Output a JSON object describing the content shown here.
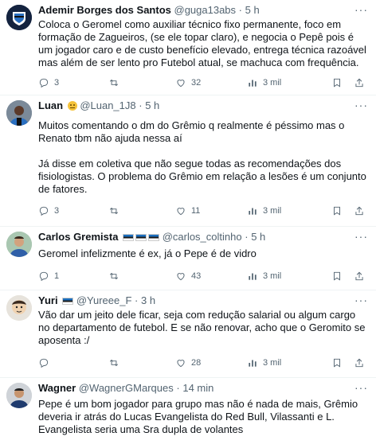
{
  "tweets": [
    {
      "name": "Ademir Borges dos Santos",
      "handle": "@guga13abs",
      "time": "5 h",
      "lines": [
        "Coloca o Geromel como auxiliar técnico fixo permanente, foco em formação de Zagueiros, (se ele topar claro), e negocia o Pepê pois é um jogador caro e de custo benefício elevado, entrega técnica razoável mas além de ser lento pro Futebol atual, se machuca com frequência."
      ],
      "replies": "3",
      "retweets": "",
      "likes": "32",
      "views": "3 mil",
      "avatar": "gremio-crest-avatar"
    },
    {
      "name": "Luan",
      "handle": "@Luan_1J8",
      "time": "5 h",
      "lines": [
        "Muitos comentando o dm do Grêmio q realmente é péssimo mas o Renato tbm não ajuda nessa aí",
        "Já disse em coletiva que não segue todas as recomendações dos fisiologistas. O problema do Grêmio em relação a lesões é um conjunto de fatores."
      ],
      "replies": "3",
      "retweets": "",
      "likes": "11",
      "views": "3 mil",
      "avatar": "player-photo-avatar"
    },
    {
      "name": "Carlos Gremista",
      "handle": "@carlos_coltinho",
      "time": "5 h",
      "lines": [
        "Geromel infelizmente é ex, já o Pepe é de vidro"
      ],
      "replies": "1",
      "retweets": "",
      "likes": "43",
      "views": "3 mil",
      "avatar": "man-photo-avatar"
    },
    {
      "name": "Yuri",
      "handle": "@Yureee_F",
      "time": "3 h",
      "lines": [
        "Vão dar um jeito dele ficar, seja com redução salarial ou algum cargo no departamento de futebol. E se não renovar, acho que o Geromito se aposenta :/"
      ],
      "replies": "",
      "retweets": "",
      "likes": "28",
      "views": "3 mil",
      "avatar": "cartoon-avatar"
    },
    {
      "name": "Wagner",
      "handle": "@WagnerGMarques",
      "time": "14 min",
      "lines": [
        "Pepe é um bom jogador para grupo mas não é nada de mais, Grêmio deveria ir atrás do Lucas Evangelista do Red Bull, Vilassanti e L. Evangelista seria uma Sra dupla de volantes"
      ],
      "replies": "",
      "retweets": "",
      "likes": "",
      "views": "",
      "avatar": "wagner-photo-avatar"
    }
  ],
  "colors": {
    "text": "#0f1419",
    "muted": "#536471",
    "divider": "#eff3f4"
  },
  "icons": [
    "reply-icon",
    "retweet-icon",
    "like-icon",
    "views-icon",
    "bookmark-icon",
    "share-icon",
    "more-icon"
  ]
}
